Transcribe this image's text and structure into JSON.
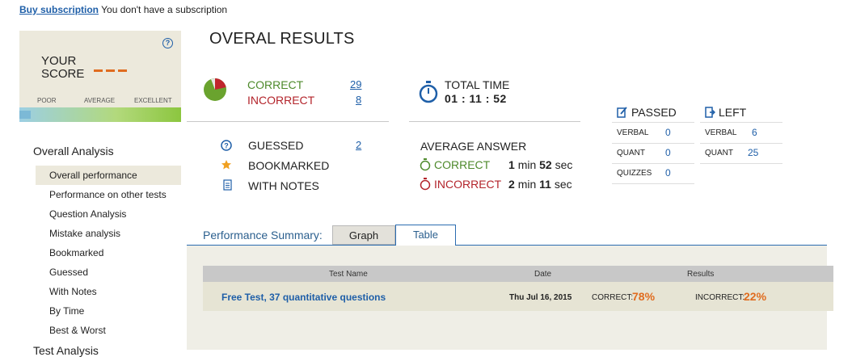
{
  "topbar": {
    "link": "Buy subscription",
    "text": "You don't have a subscription"
  },
  "score": {
    "label_line1": "YOUR",
    "label_line2": "SCORE",
    "value": "---",
    "scale": [
      "POOR",
      "AVERAGE",
      "EXCELLENT"
    ],
    "help_icon": "question-circle-icon"
  },
  "sidebar": {
    "heading": "Overall Analysis",
    "items": [
      {
        "label": "Overall performance",
        "active": true
      },
      {
        "label": "Performance on other tests"
      },
      {
        "label": "Question Analysis"
      },
      {
        "label": "Mistake analysis"
      },
      {
        "label": "Bookmarked"
      },
      {
        "label": "Guessed"
      },
      {
        "label": "With Notes"
      },
      {
        "label": "By Time"
      },
      {
        "label": "Best & Worst"
      }
    ],
    "next_heading": "Test Analysis"
  },
  "main": {
    "title": "OVERAL RESULTS",
    "correct": {
      "label": "CORRECT",
      "value": "29"
    },
    "incorrect": {
      "label": "INCORRECT",
      "value": "8"
    },
    "pie": {
      "correct": 29,
      "incorrect": 8,
      "colors": {
        "correct": "#6aa32e",
        "incorrect": "#c0262d"
      }
    },
    "guessed": {
      "label": "GUESSED",
      "value": "2"
    },
    "bookmarked": {
      "label": "BOOKMARKED"
    },
    "with_notes": {
      "label": "WITH NOTES"
    },
    "total_time": {
      "label": "TOTAL TIME",
      "value": "01 : 11 : 52"
    },
    "average_answer": {
      "label": "AVERAGE ANSWER",
      "correct": {
        "label": "CORRECT",
        "min": "1",
        "min_unit": "min",
        "sec": "52",
        "sec_unit": "sec"
      },
      "incorrect": {
        "label": "INCORRECT",
        "min": "2",
        "min_unit": "min",
        "sec": "11",
        "sec_unit": "sec"
      }
    },
    "passed": {
      "label": "PASSED",
      "rows": [
        {
          "key": "VERBAL",
          "value": "0"
        },
        {
          "key": "QUANT",
          "value": "0"
        },
        {
          "key": "QUIZZES",
          "value": "0"
        }
      ]
    },
    "left": {
      "label": "LEFT",
      "rows": [
        {
          "key": "VERBAL",
          "value": "6"
        },
        {
          "key": "QUANT",
          "value": "25"
        }
      ]
    }
  },
  "summary": {
    "label": "Performance Summary:",
    "tabs": [
      "Graph",
      "Table"
    ],
    "active_tab": "Table",
    "columns": [
      "Test Name",
      "Date",
      "Results"
    ],
    "rows": [
      {
        "name": "Free Test, 37 quantitative questions",
        "date": "Thu Jul 16, 2015",
        "correct_label": "CORRECT:",
        "correct_value": "78%",
        "incorrect_label": "INCORRECT:",
        "incorrect_value": "22%"
      }
    ]
  },
  "colors": {
    "link": "#1f5fa8",
    "correct": "#4e8a2c",
    "incorrect": "#b3242b",
    "accent_orange": "#e06c1f",
    "panel_bg": "#ece9dc"
  }
}
